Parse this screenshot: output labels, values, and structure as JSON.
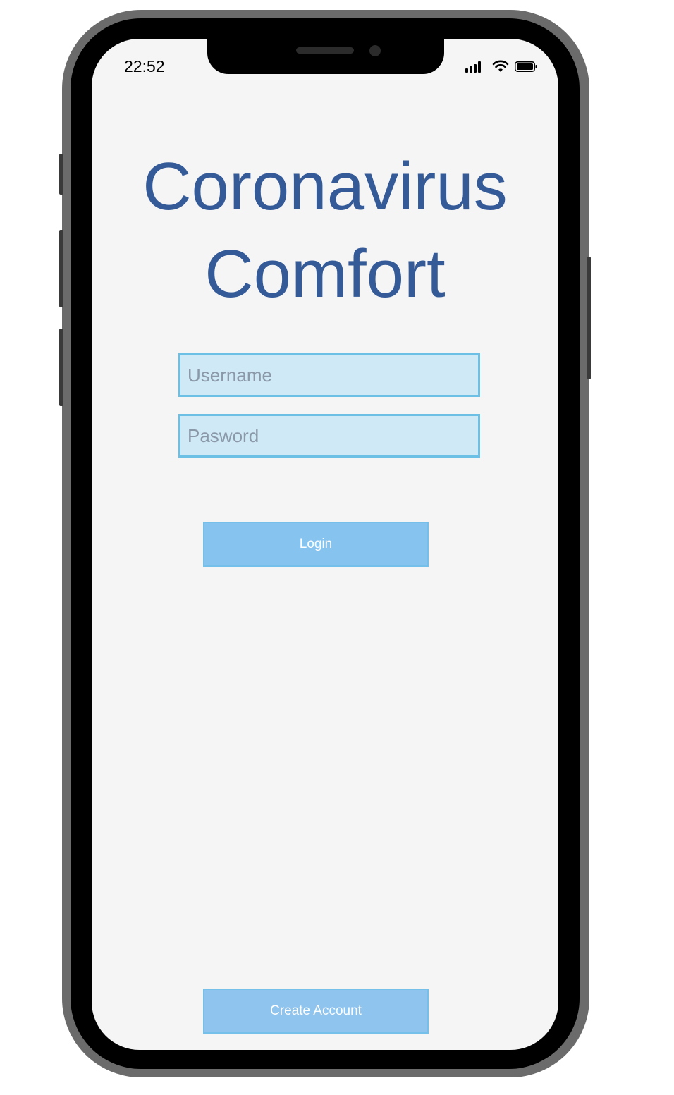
{
  "status_bar": {
    "time": "22:52",
    "icons": [
      "cellular-signal-icon",
      "wifi-icon",
      "battery-icon"
    ]
  },
  "app": {
    "title_line1": "Coronavirus",
    "title_line2": "Comfort"
  },
  "form": {
    "username_placeholder": "Username",
    "password_placeholder": "Pasword",
    "username_value": "",
    "password_value": ""
  },
  "buttons": {
    "login_label": "Login",
    "create_account_label": "Create Account"
  },
  "colors": {
    "title": "#345a98",
    "field_bg": "#cfe9f6",
    "field_border": "#6cc0e6",
    "button_bg": "#87c3ef",
    "screen_bg": "#f5f5f5"
  }
}
